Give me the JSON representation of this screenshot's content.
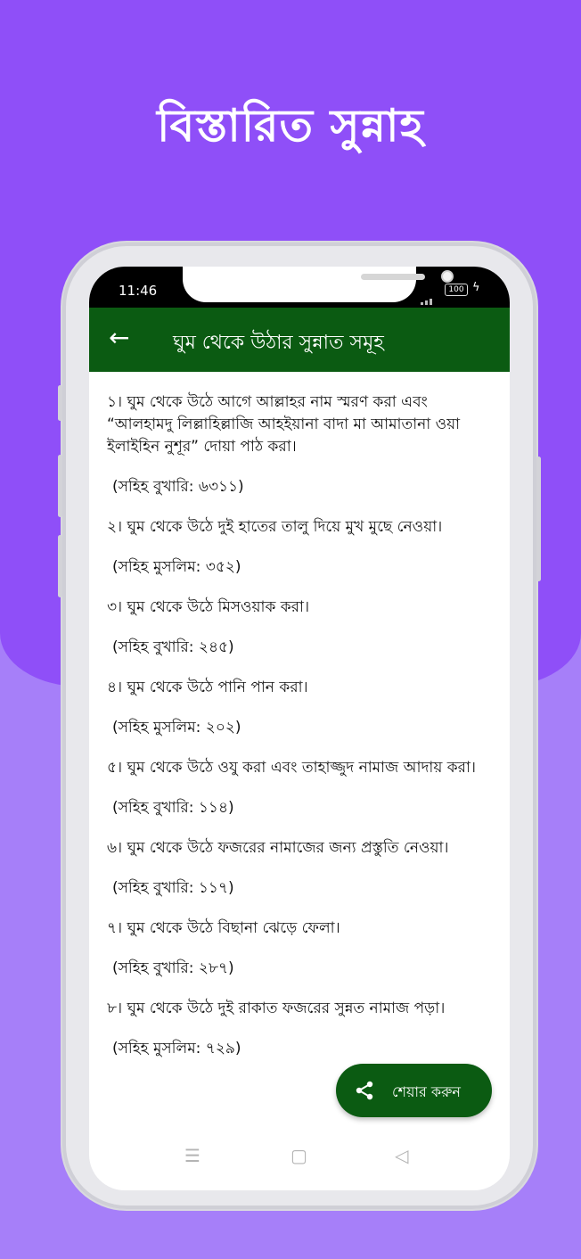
{
  "promo": {
    "headline": "বিস্তারিত সুন্নাহ"
  },
  "status_bar": {
    "time": "11:46",
    "battery": "100"
  },
  "app_bar": {
    "title": "ঘুম থেকে উঠার সুন্নাত সমূহ"
  },
  "items": [
    {
      "text": "১। ঘুম থেকে উঠে আগে আল্লাহর নাম স্মরণ করা এবং “আলহামদু লিল্লাহিল্লাজি আহইয়ানা বাদা মা আমাতানা ওয়া ইলাইহিন নুশূর” দোয়া পাঠ করা।",
      "ref": "(সহিহ বুখারি: ৬৩১১)"
    },
    {
      "text": "২। ঘুম থেকে উঠে দুই হাতের তালু দিয়ে মুখ মুছে নেওয়া।",
      "ref": "(সহিহ মুসলিম: ৩৫২)"
    },
    {
      "text": "৩। ঘুম থেকে উঠে মিসওয়াক করা।",
      "ref": "(সহিহ বুখারি: ২৪৫)"
    },
    {
      "text": "৪। ঘুম থেকে উঠে পানি পান করা।",
      "ref": "(সহিহ মুসলিম: ২০২)"
    },
    {
      "text": "৫। ঘুম থেকে উঠে ওযু করা এবং তাহাজ্জুদ নামাজ আদায় করা।",
      "ref": "(সহিহ বুখারি: ১১৪)"
    },
    {
      "text": "৬। ঘুম থেকে উঠে ফজরের নামাজের জন্য প্রস্তুতি নেওয়া।",
      "ref": "(সহিহ বুখারি: ১১৭)"
    },
    {
      "text": "৭। ঘুম থেকে উঠে বিছানা ঝেড়ে ফেলা।",
      "ref": "(সহিহ বুখারি: ২৮৭)"
    },
    {
      "text": "৮। ঘুম থেকে উঠে দুই রাকাত ফজরের সুন্নত নামাজ পড়া।",
      "ref": "(সহিহ মুসলিম: ৭২৯)"
    }
  ],
  "fab": {
    "label": "শেয়ার করুন",
    "icon": "share-icon"
  },
  "nav": {
    "menu": "☰",
    "home": "▢",
    "back": "◁"
  },
  "colors": {
    "appbar": "#0b5b12",
    "promo_bg": "#8f4ff8",
    "bottom_bg": "#a67ff9"
  }
}
